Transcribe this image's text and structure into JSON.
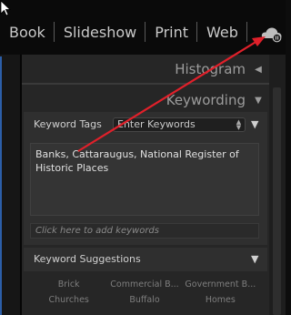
{
  "modules": [
    "Book",
    "Slideshow",
    "Print",
    "Web"
  ],
  "cloud_icon": "cloud-sync-icon",
  "panels": {
    "histogram": {
      "title": "Histogram"
    },
    "keywording": {
      "title": "Keywording"
    }
  },
  "keyword_tags": {
    "label": "Keyword Tags",
    "mode": "Enter Keywords",
    "keywords": "Banks, Cattaraugus, National Register of Historic Places",
    "add_placeholder": "Click here to add keywords"
  },
  "suggestions": {
    "label": "Keyword Suggestions",
    "items": [
      "Brick",
      "Commercial B...",
      "Government B...",
      "Churches",
      "Buffalo",
      "Homes"
    ]
  },
  "colors": {
    "annotation_arrow": "#e0202a",
    "accent_blue": "#2c5ea8"
  }
}
